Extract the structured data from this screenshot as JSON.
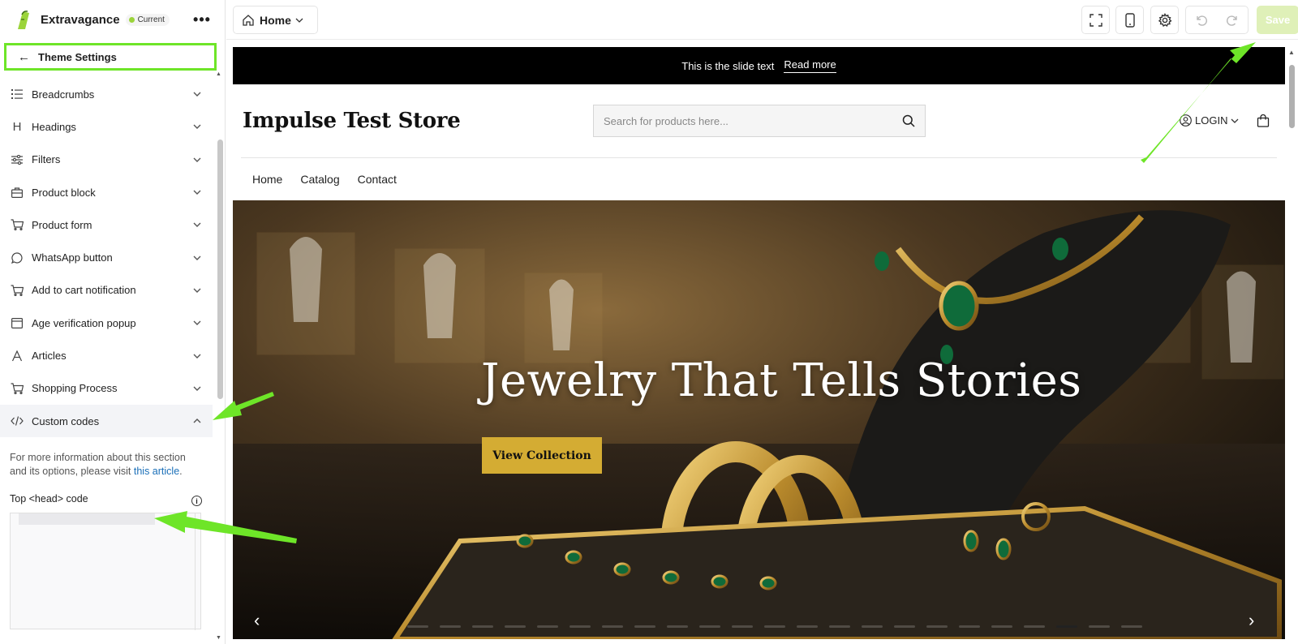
{
  "app": {
    "name": "Extravagance",
    "badge": "Current",
    "more": "•••"
  },
  "sidebar": {
    "back_label": "Theme Settings",
    "items": [
      {
        "label": "Breadcrumbs",
        "icon": "list-icon"
      },
      {
        "label": "Headings",
        "icon": "heading-icon"
      },
      {
        "label": "Filters",
        "icon": "sliders-icon"
      },
      {
        "label": "Product block",
        "icon": "bag-icon"
      },
      {
        "label": "Product form",
        "icon": "cart-icon"
      },
      {
        "label": "WhatsApp button",
        "icon": "chat-icon"
      },
      {
        "label": "Add to cart notification",
        "icon": "cart-icon"
      },
      {
        "label": "Age verification popup",
        "icon": "window-icon"
      },
      {
        "label": "Articles",
        "icon": "text-icon"
      },
      {
        "label": "Shopping Process",
        "icon": "cart-icon"
      },
      {
        "label": "Custom codes",
        "icon": "code-icon"
      }
    ],
    "info_prefix": "For more information about this section and its options, please visit ",
    "info_link": "this article",
    "info_suffix": ".",
    "field_label": "Top <head> code",
    "info_icon": "i"
  },
  "topbar": {
    "page": "Home",
    "save": "Save"
  },
  "preview": {
    "announcement": "This is the slide text",
    "announcement_link": "Read more",
    "store_name": "Impulse Test Store",
    "search_placeholder": "Search for products here...",
    "login": "LOGIN",
    "nav": [
      "Home",
      "Catalog",
      "Contact"
    ],
    "hero_title": "Jewelry That Tells Stories",
    "hero_button": "View Collection",
    "hero_prev": "‹",
    "hero_next": "›"
  },
  "colors": {
    "accent_green": "#6ee528",
    "save_disabled": "#dff0b8",
    "hero_button": "#d4ac33",
    "announcement_bg": "#000000",
    "link_blue": "#1a6fb8"
  }
}
